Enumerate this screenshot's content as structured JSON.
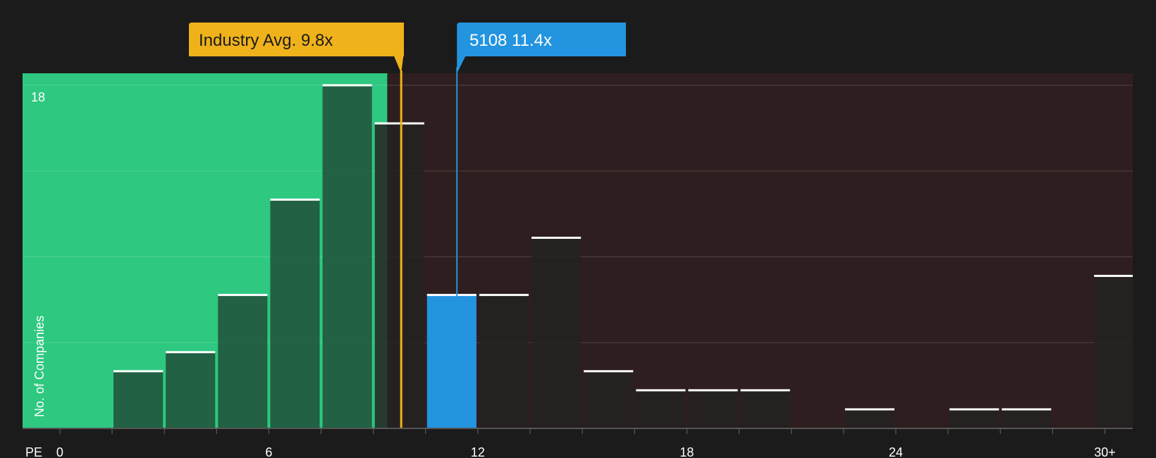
{
  "chart_data": {
    "type": "bar",
    "xlabel": "PE",
    "ylabel": "No. of Companies",
    "x_ticks": [
      "0",
      "6",
      "12",
      "18",
      "24",
      "30+"
    ],
    "x_tick_values": [
      0,
      6,
      12,
      18,
      24,
      30
    ],
    "xlim": [
      -1.07,
      30.8
    ],
    "y_top_label": "18",
    "ylim": [
      0,
      18
    ],
    "grid": true,
    "bin_width": 1.5,
    "bins": [
      {
        "x": 2.25,
        "value": 3
      },
      {
        "x": 3.75,
        "value": 4
      },
      {
        "x": 5.25,
        "value": 7
      },
      {
        "x": 6.75,
        "value": 12
      },
      {
        "x": 8.25,
        "value": 18
      },
      {
        "x": 9.75,
        "value": 16
      },
      {
        "x": 11.25,
        "value": 7,
        "highlight": true
      },
      {
        "x": 12.75,
        "value": 7
      },
      {
        "x": 14.25,
        "value": 10
      },
      {
        "x": 15.75,
        "value": 3
      },
      {
        "x": 17.25,
        "value": 2
      },
      {
        "x": 18.75,
        "value": 2
      },
      {
        "x": 20.25,
        "value": 2
      },
      {
        "x": 23.25,
        "value": 1
      },
      {
        "x": 26.25,
        "value": 1
      },
      {
        "x": 27.75,
        "value": 1
      },
      {
        "x": 30.4,
        "value": 8
      }
    ],
    "fair_region_max": 9.4,
    "industry_avg": {
      "label": "Industry Avg. 9.8x",
      "value": 9.8
    },
    "company": {
      "label": "5108 11.4x",
      "value": 11.4
    },
    "colors": {
      "background": "#1b1b1b",
      "fair": "#2ec880",
      "expensive": "#2f1e1f",
      "bar_fair": "#22583e",
      "bar_expensive": "#242222",
      "bar_top": "#ffffff",
      "highlight": "#2394e0",
      "industry": "#f0b21b",
      "grid": "#ffffff",
      "text": "#ffffff"
    }
  }
}
